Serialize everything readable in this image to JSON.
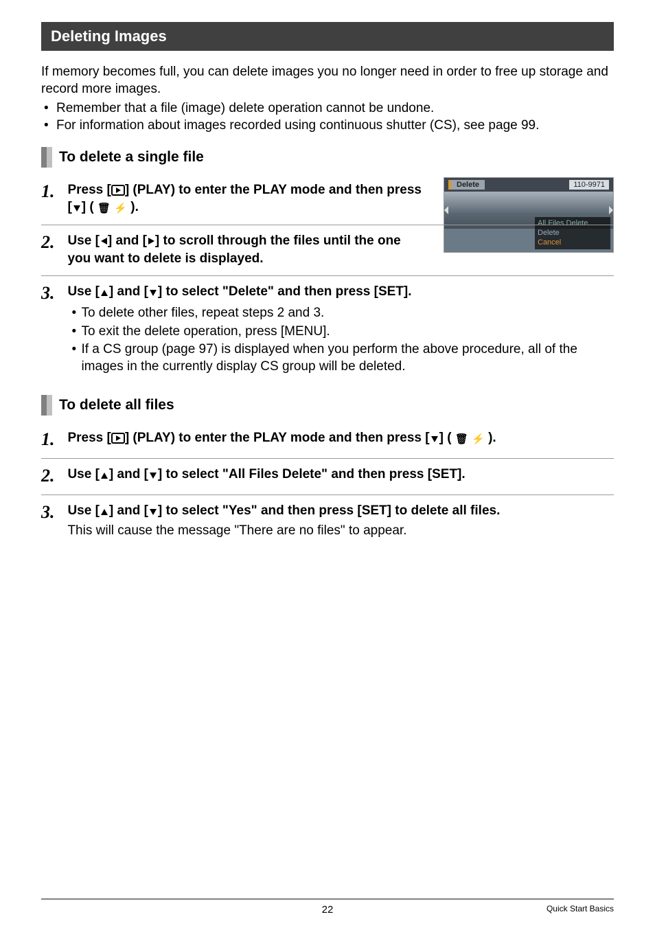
{
  "section_header": "Deleting Images",
  "intro": "If memory becomes full, you can delete images you no longer need in order to free up storage and record more images.",
  "tips": [
    "Remember that a file (image) delete operation cannot be undone.",
    "For information about images recorded using continuous shutter (CS), see page 99."
  ],
  "sub1_title": "To delete a single file",
  "sub1_steps": {
    "s1_a": "Press [",
    "s1_b": "] (PLAY) to enter the PLAY mode and then press [",
    "s1_c": "] (",
    "s1_d": ").",
    "s2": "Use [",
    "s2_mid": "] and [",
    "s2_end": "] to scroll through the files until the one you want to delete is displayed.",
    "s3": "Use [",
    "s3_mid": "] and [",
    "s3_end": "] to select \"Delete\" and then press [SET].",
    "s3_bullets": [
      "To delete other files, repeat steps 2 and 3.",
      "To exit the delete operation, press [MENU].",
      "If a CS group (page 97) is displayed when you perform the above procedure, all of the images in the currently display CS group will be deleted."
    ]
  },
  "sub2_title": "To delete all files",
  "sub2_steps": {
    "s1_a": "Press [",
    "s1_b": "] (PLAY) to enter the PLAY mode and then press [",
    "s1_c": "] (",
    "s1_d": ").",
    "s2": "Use [",
    "s2_mid": "] and [",
    "s2_end": "] to select \"All Files Delete\" and then press [SET].",
    "s3": "Use [",
    "s3_mid": "] and [",
    "s3_end": "] to select \"Yes\" and then press [SET] to delete all files.",
    "s3_sub": "This will cause the message \"There are no files\" to appear."
  },
  "figure": {
    "tab": "Delete",
    "counter": "110-9971",
    "menu": [
      "All Files Delete",
      "Delete",
      "Cancel"
    ]
  },
  "footer": {
    "page": "22",
    "section": "Quick Start Basics"
  }
}
